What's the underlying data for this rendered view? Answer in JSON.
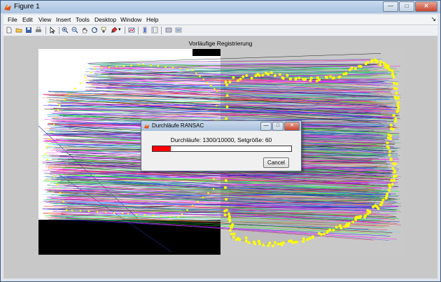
{
  "window": {
    "title": "Figure 1"
  },
  "menu": {
    "items": [
      "File",
      "Edit",
      "View",
      "Insert",
      "Tools",
      "Desktop",
      "Window",
      "Help"
    ]
  },
  "toolbar": {
    "icons": [
      "new-figure-icon",
      "open-file-icon",
      "save-icon",
      "print-icon",
      "select-arrow-icon",
      "zoom-in-icon",
      "zoom-out-icon",
      "pan-hand-icon",
      "rotate-3d-icon",
      "data-cursor-icon",
      "brush-icon",
      "link-plot-icon",
      "insert-colorbar-icon",
      "insert-legend-icon",
      "hide-plot-tools-icon",
      "show-plot-tools-icon"
    ]
  },
  "figure": {
    "axes_title": "Vorläufige Registrierung",
    "plot_image": "feature-match-lines-image",
    "colors": {
      "match_line_palette": [
        "#e6194b",
        "#3cb44b",
        "#4363d8",
        "#f58231",
        "#911eb4",
        "#42d4f4",
        "#f032e6",
        "#000000",
        "#0000ff",
        "#008080",
        "#ff00ff",
        "#00ff00"
      ],
      "border_markers": "#ffff00"
    }
  },
  "dialog": {
    "title": "Durchläufe RANSAC",
    "message": "Durchläufe: 1300/10000, Setgröße: 60",
    "progress": 0.13,
    "cancel_label": "Cancel",
    "bar_color": "#ff0000"
  }
}
